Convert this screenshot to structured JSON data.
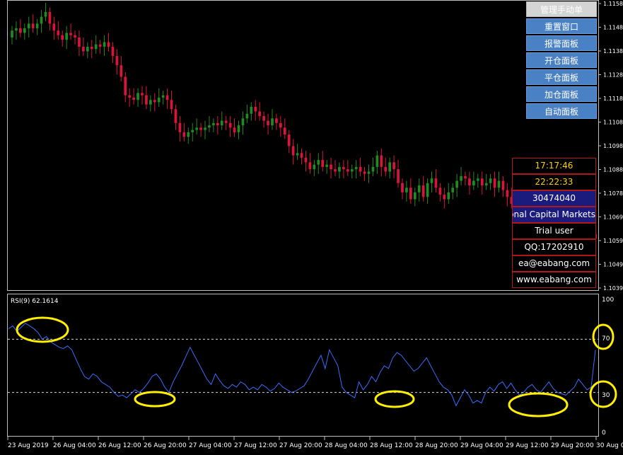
{
  "price_axis": {
    "labels": [
      "1.1158",
      "1.1148",
      "1.1138",
      "1.1128",
      "1.1118",
      "1.1108",
      "1.1098",
      "1.1088",
      "1.1078",
      "1.1069",
      "1.1059",
      "1.1049",
      "1.1039"
    ]
  },
  "rsi_panel": {
    "label": "RSI(9) 62.1614",
    "levels": [
      "100",
      "70",
      "30",
      "0"
    ]
  },
  "time_axis": {
    "labels": [
      "23 Aug 2019",
      "26 Aug 04:00",
      "26 Aug 12:00",
      "26 Aug 20:00",
      "27 Aug 04:00",
      "27 Aug 12:00",
      "27 Aug 20:00",
      "28 Aug 04:00",
      "28 Aug 12:00",
      "28 Aug 20:00",
      "29 Aug 04:00",
      "29 Aug 12:00",
      "29 Aug 20:00",
      "30 Aug 0"
    ]
  },
  "control_panel": {
    "buttons": [
      "管理手动单",
      "重置窗口",
      "报警面板",
      "开仓面板",
      "平仓面板",
      "加仓面板",
      "自动面板"
    ]
  },
  "info_panel": {
    "time1": "17:17:46",
    "time2": "22:22:33",
    "account": "30474040",
    "broker": "onal Capital Markets",
    "license": "Trial user",
    "qq": "QQ:17202910",
    "email": "ea@eabang.com",
    "website": "www.eabang.com"
  },
  "colors": {
    "bull": "#1f8c1f",
    "bear": "#dc143c",
    "rsi": "#3a6cff",
    "highlight": "#ffee00"
  },
  "chart_data": [
    {
      "type": "candlestick",
      "title": "",
      "y_tick_labels": [
        "1.1158",
        "1.1148",
        "1.1138",
        "1.1128",
        "1.1118",
        "1.1108",
        "1.1098",
        "1.1088",
        "1.1078",
        "1.1069",
        "1.1059",
        "1.1049",
        "1.1039"
      ],
      "x_tick_labels": [
        "23 Aug 2019",
        "26 Aug 04:00",
        "26 Aug 12:00",
        "26 Aug 20:00",
        "27 Aug 04:00",
        "27 Aug 12:00",
        "27 Aug 20:00",
        "28 Aug 04:00",
        "28 Aug 12:00",
        "28 Aug 20:00",
        "29 Aug 04:00",
        "29 Aug 12:00",
        "29 Aug 20:00",
        "30 Aug 0"
      ],
      "ylim": [
        1.1036,
        1.116
      ],
      "close": [
        1.1148,
        1.1149,
        1.1147,
        1.1149,
        1.1151,
        1.1149,
        1.1151,
        1.1154,
        1.1156,
        1.1151,
        1.1148,
        1.1146,
        1.1144,
        1.1147,
        1.1146,
        1.1145,
        1.1141,
        1.1139,
        1.1141,
        1.114,
        1.1142,
        1.1141,
        1.1143,
        1.1141,
        1.1137,
        1.1133,
        1.1128,
        1.112,
        1.1119,
        1.1118,
        1.1121,
        1.112,
        1.1116,
        1.1118,
        1.1117,
        1.1119,
        1.112,
        1.1118,
        1.1114,
        1.1108,
        1.1104,
        1.1102,
        1.1104,
        1.1105,
        1.1106,
        1.1105,
        1.1106,
        1.1107,
        1.1108,
        1.1107,
        1.1109,
        1.1108,
        1.1106,
        1.1104,
        1.1107,
        1.111,
        1.1112,
        1.1115,
        1.1113,
        1.1111,
        1.1109,
        1.1107,
        1.111,
        1.1108,
        1.1106,
        1.1103,
        1.1098,
        1.1094,
        1.1095,
        1.1093,
        1.1091,
        1.1088,
        1.109,
        1.1092,
        1.1089,
        1.109,
        1.1088,
        1.1087,
        1.1089,
        1.1088,
        1.1087,
        1.1088,
        1.1089,
        1.1087,
        1.1086,
        1.1087,
        1.1089,
        1.1094,
        1.1089,
        1.1087,
        1.1091,
        1.1088,
        1.1082,
        1.1078,
        1.108,
        1.1075,
        1.1078,
        1.1081,
        1.1076,
        1.1082,
        1.1084,
        1.108,
        1.1077,
        1.1075,
        1.1078,
        1.108,
        1.1083,
        1.1085,
        1.1084,
        1.1081,
        1.1083,
        1.1084,
        1.1081,
        1.1082,
        1.1084,
        1.108,
        1.1083,
        1.1079,
        1.1076,
        1.1073,
        1.1071,
        1.1073,
        1.107,
        1.1068,
        1.1066,
        1.1065,
        1.1068,
        1.1066,
        1.1064,
        1.1066,
        1.1064,
        1.1062,
        1.106,
        1.1058,
        1.1059,
        1.1061,
        1.106,
        1.1062,
        1.106,
        1.1058
      ],
      "rsi": {
        "name": "RSI(9) 62.1614",
        "ylim": [
          0,
          100
        ],
        "levels": [
          30,
          70
        ],
        "values": [
          78,
          80,
          76,
          79,
          82,
          80,
          78,
          75,
          70,
          72,
          68,
          66,
          64,
          63,
          65,
          62,
          55,
          48,
          42,
          40,
          44,
          42,
          38,
          36,
          34,
          30,
          27,
          28,
          26,
          29,
          32,
          30,
          33,
          37,
          42,
          44,
          40,
          34,
          30,
          38,
          44,
          50,
          57,
          64,
          58,
          52,
          46,
          40,
          36,
          44,
          39,
          35,
          33,
          36,
          34,
          38,
          36,
          32,
          34,
          32,
          36,
          34,
          31,
          33,
          37,
          34,
          32,
          30,
          31,
          33,
          35,
          40,
          46,
          52,
          58,
          48,
          62,
          56,
          50,
          34,
          30,
          28,
          26,
          38,
          32,
          36,
          42,
          38,
          45,
          50,
          48,
          56,
          60,
          58,
          54,
          50,
          46,
          48,
          52,
          56,
          50,
          44,
          38,
          34,
          32,
          28,
          20,
          26,
          32,
          28,
          22,
          24,
          22,
          30,
          34,
          31,
          36,
          38,
          33,
          37,
          32,
          28,
          30,
          34,
          36,
          32,
          30,
          34,
          38,
          33,
          30,
          29,
          28,
          31,
          34,
          40,
          36,
          32,
          34,
          62
        ]
      }
    }
  ]
}
